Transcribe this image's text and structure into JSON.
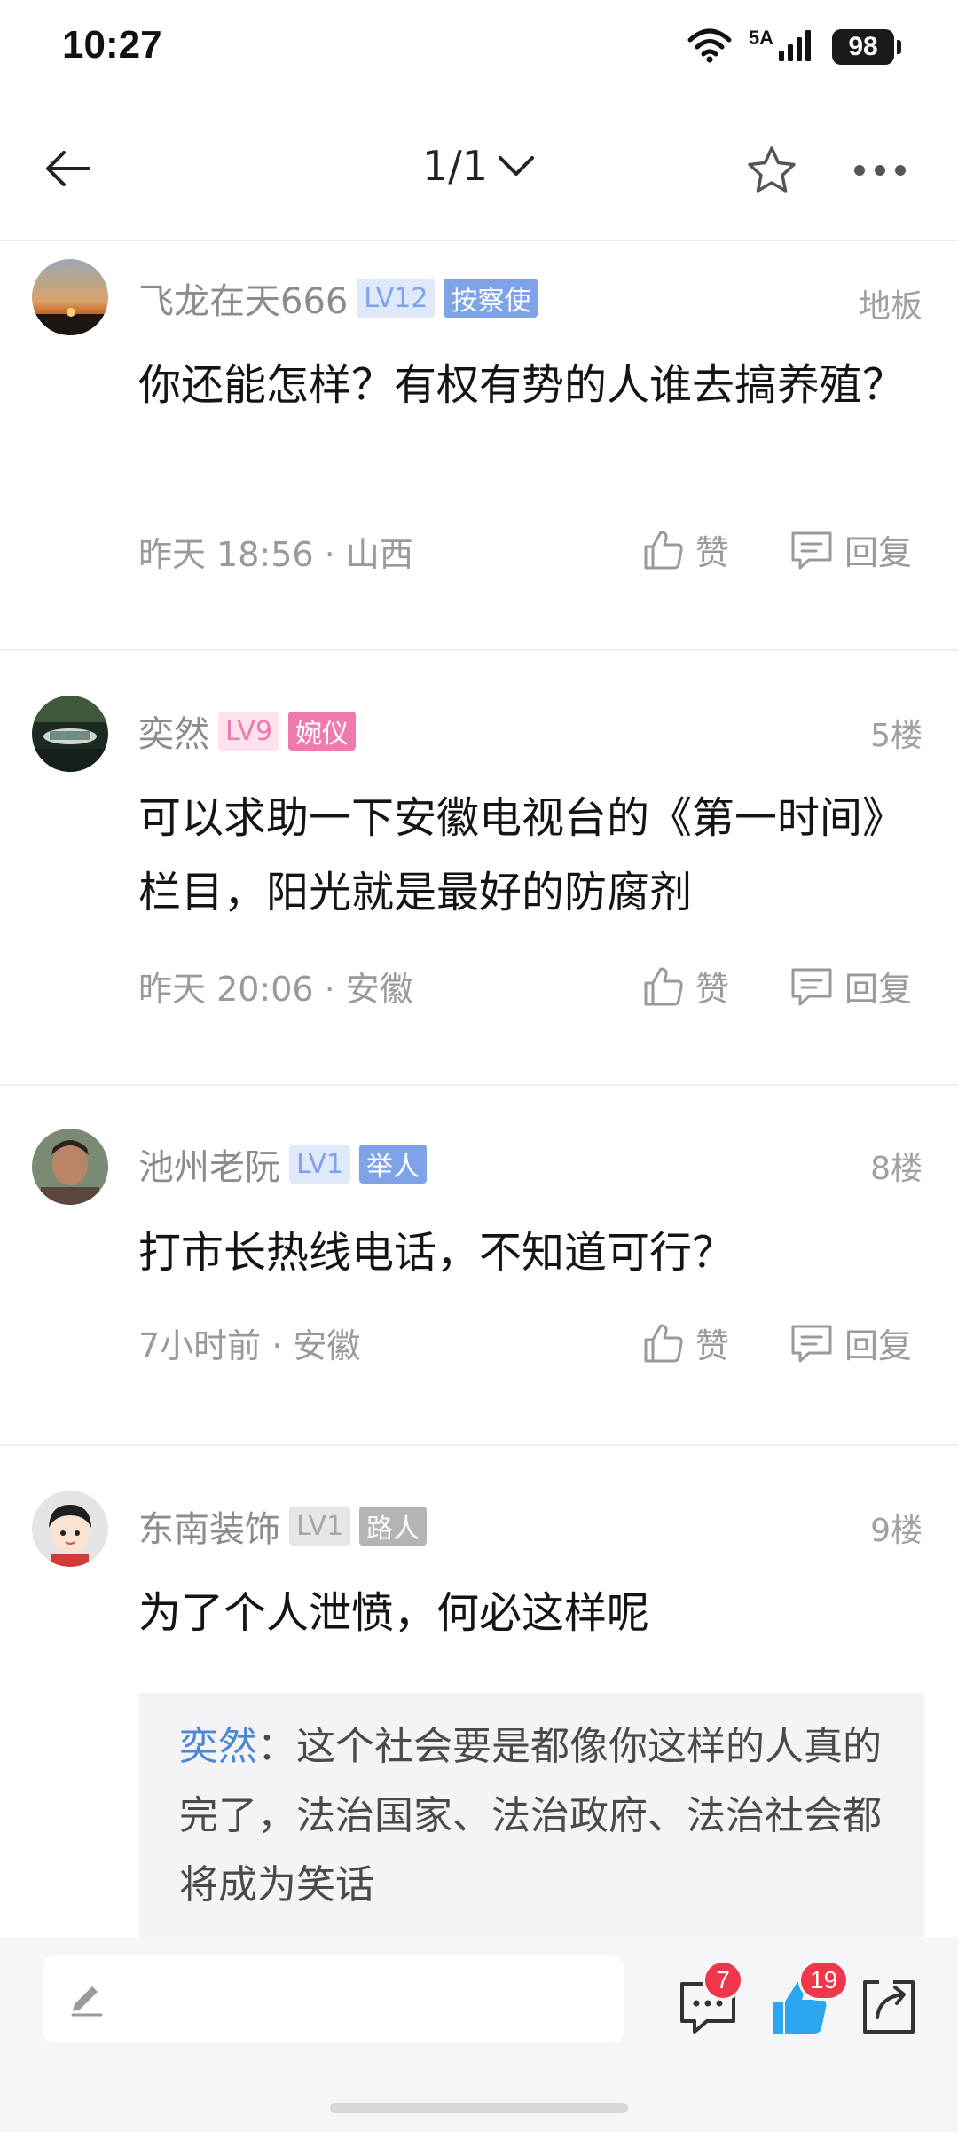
{
  "status_bar": {
    "time": "10:27",
    "network": "5A",
    "battery": "98"
  },
  "nav": {
    "page_indicator": "1/1"
  },
  "posts": [
    {
      "username": "飞龙在天666",
      "level": "LV12",
      "title": "按察使",
      "floor": "地板",
      "content": "你还能怎样？有权有势的人谁去搞养殖？",
      "time_location": "昨天 18:56 · 山西",
      "like_label": "赞",
      "reply_label": "回复"
    },
    {
      "username": "奕然",
      "level": "LV9",
      "title": "婉仪",
      "floor": "5楼",
      "content": "可以求助一下安徽电视台的《第一时间》栏目，阳光就是最好的防腐剂",
      "time_location": "昨天 20:06 · 安徽",
      "like_label": "赞",
      "reply_label": "回复"
    },
    {
      "username": "池州老阮",
      "level": "LV1",
      "title": "举人",
      "floor": "8楼",
      "content": "打市长热线电话，不知道可行？",
      "time_location": "7小时前 · 安徽",
      "like_label": "赞",
      "reply_label": "回复"
    },
    {
      "username": "东南装饰",
      "level": "LV1",
      "title": "路人",
      "floor": "9楼",
      "content": "为了个人泄愤，何必这样呢",
      "quote_author": "奕然",
      "quote_sep": "：",
      "quote_text": "这个社会要是都像你这样的人真的完了，法治国家、法治政府、法治社会都将成为笑话"
    }
  ],
  "bottom_bar": {
    "comment_count": "7",
    "like_count": "19"
  },
  "colors": {
    "accent_blue": "#4a87d6",
    "badge_red": "#f0364a",
    "like_blue": "#2aa7f0"
  }
}
